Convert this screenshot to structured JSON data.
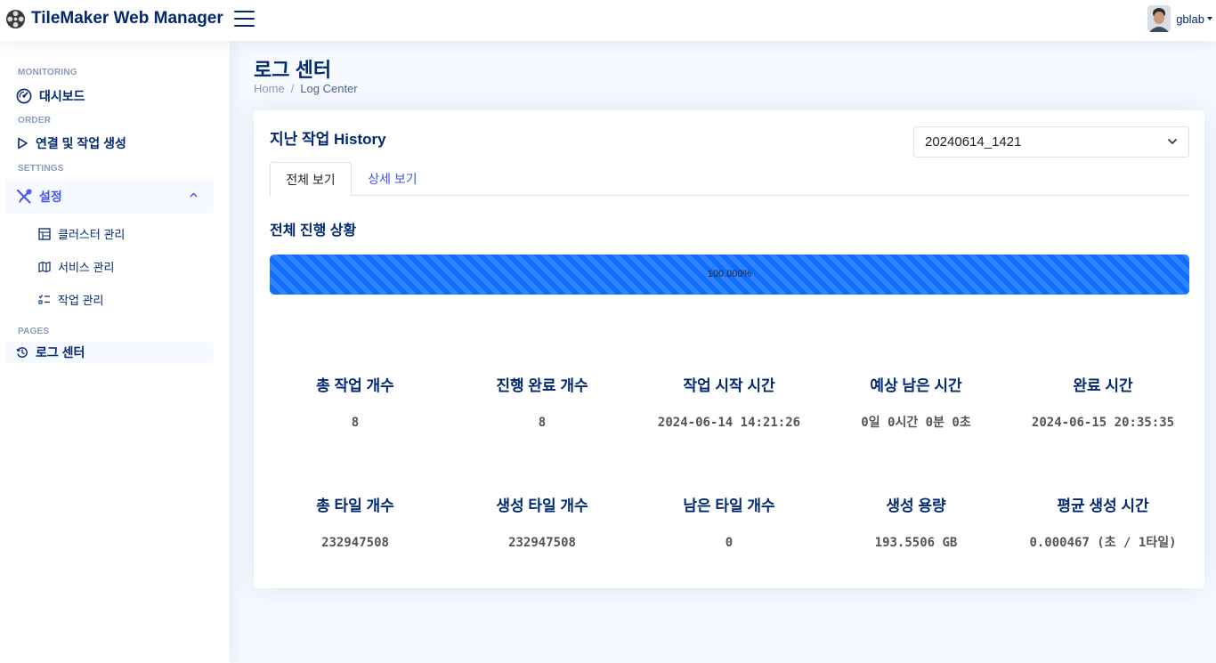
{
  "header": {
    "title": "TileMaker Web Manager",
    "user": "gblab"
  },
  "sidebar": {
    "headings": [
      "MONITORING",
      "ORDER",
      "SETTINGS",
      "PAGES"
    ],
    "dashboard": "대시보드",
    "order_link": "연결 및 작업 생성",
    "settings": "설정",
    "sub_items": [
      "클러스터 관리",
      "서비스 관리",
      "작업 관리"
    ],
    "log_center": "로그 센터"
  },
  "page": {
    "title": "로그 센터",
    "breadcrumb_home": "Home",
    "breadcrumb_sep": "/",
    "breadcrumb_current": "Log Center"
  },
  "card": {
    "title_prefix": "지난 작업 ",
    "title_bold": "History",
    "selected_history": "20240614_1421",
    "tabs": [
      "전체 보기",
      "상세 보기"
    ],
    "section_title": "전체 진행 상황",
    "progress_text": "100.000%",
    "progress_fraction": 1.0
  },
  "stats": {
    "row1": [
      {
        "label": "총 작업 개수",
        "value": "8"
      },
      {
        "label": "진행 완료 개수",
        "value": "8"
      },
      {
        "label": "작업 시작 시간",
        "value": "2024-06-14 14:21:26"
      },
      {
        "label": "예상 남은 시간",
        "value": "0일 0시간 0분 0초"
      },
      {
        "label": "완료 시간",
        "value": "2024-06-15 20:35:35"
      }
    ],
    "row2": [
      {
        "label": "총 타일 개수",
        "value": "232947508"
      },
      {
        "label": "생성 타일 개수",
        "value": "232947508"
      },
      {
        "label": "남은 타일 개수",
        "value": "0"
      },
      {
        "label": "생성 용량",
        "value": "193.5506 GB"
      },
      {
        "label": "평균 생성 시간",
        "value": "0.000467 (초 / 1타일)"
      }
    ]
  },
  "icons": {
    "logo": "film-reel-icon",
    "menu": "hamburger-menu-icon",
    "dashboard": "speedometer-icon",
    "order": "play-icon",
    "settings": "tools-icon",
    "cluster": "layout-icon",
    "service": "map-icon",
    "task": "list-check-icon",
    "log": "history-icon"
  }
}
